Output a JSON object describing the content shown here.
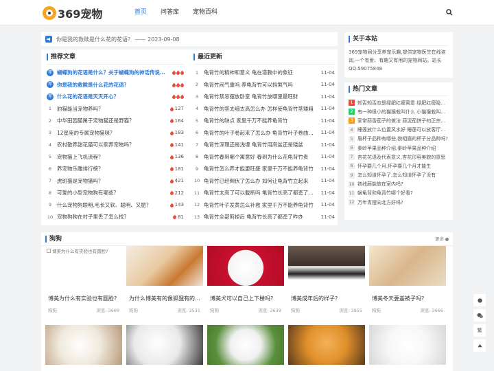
{
  "header": {
    "logo_text": "369宠物",
    "nav": [
      "首页",
      "问答库",
      "宠物百科"
    ]
  },
  "notice": {
    "text": "你是我的救赎是什么花的花语？ —— 2023-09-08"
  },
  "recommended": {
    "title": "推荐文章",
    "items": [
      {
        "rank": "荐",
        "title": "蝴蝶狗的花语是什么？关于蝴蝶狗的神话传说是...",
        "meta": "",
        "top": true
      },
      {
        "rank": "荐",
        "title": "你是我的救赎是什么花的花语？",
        "meta": "",
        "top": true
      },
      {
        "rank": "荐",
        "title": "什么花的花语是天天开心？",
        "meta": "",
        "top": true
      },
      {
        "rank": "1",
        "title": "豹猫能当宠物养吗？",
        "meta": "127",
        "top": false
      },
      {
        "rank": "2",
        "title": "中华田园猫属于宠物猫还是野猫？",
        "meta": "164",
        "top": false
      },
      {
        "rank": "3",
        "title": "12星座的专属宠物猫咪？",
        "meta": "183",
        "top": false
      },
      {
        "rank": "4",
        "title": "农村散养甜花猫可以家养宠物吗？",
        "meta": "141",
        "top": false
      },
      {
        "rank": "5",
        "title": "宠物猫上飞机流程？",
        "meta": "136",
        "top": false
      },
      {
        "rank": "6",
        "title": "养宠物乐雕排行榜？",
        "meta": "181",
        "top": false
      },
      {
        "rank": "7",
        "title": "虎斑猫是宠物猫吗？",
        "meta": "421",
        "top": false
      },
      {
        "rank": "8",
        "title": "可爱的小型宠物狗有哪些？",
        "meta": "212",
        "top": false
      },
      {
        "rank": "9",
        "title": "什么宠物狗眼明,毛长又软、聪明、又肥？",
        "meta": "143",
        "top": false
      },
      {
        "rank": "10",
        "title": "宠物狗狗在村子里丢了怎么找？",
        "meta": "81",
        "top": false
      }
    ]
  },
  "latest": {
    "title": "最近更新",
    "items": [
      {
        "rank": "1",
        "title": "龟背竹的精神和意义 龟在道教中的象征",
        "date": "11-04"
      },
      {
        "rank": "2",
        "title": "龟背竹闹气重吗 养龟背竹可以挡煞气吗",
        "date": "11-04"
      },
      {
        "rank": "3",
        "title": "龟背竹禁忌摆放卧室 龟背竹放哪里最旺财",
        "date": "11-04"
      },
      {
        "rank": "4",
        "title": "龟背竹的茎太细太高怎么办 怎样使龟背竹茎矮粗",
        "date": "11-04"
      },
      {
        "rank": "5",
        "title": "龟背竹的缺点 家里千万不能养龟背竹",
        "date": "11-04"
      },
      {
        "rank": "6",
        "title": "龟背竹的叶子卷起来了怎么办 龟背竹叶子卷曲的原因",
        "date": "11-04"
      },
      {
        "rank": "7",
        "title": "龟背竹深理还是浅埋 龟背竹用高盆还是矮盆",
        "date": "11-04"
      },
      {
        "rank": "8",
        "title": "龟背竹春到哪个寓意好 春到为什么花龟背竹贵",
        "date": "11-04"
      },
      {
        "rank": "9",
        "title": "龟背竹怎么养才能更旺盛 家里千万不能养龟背竹",
        "date": "11-04"
      },
      {
        "rank": "10",
        "title": "龟背竹已经倒伏了怎么办 如何让龟背竹立起来",
        "date": "11-04"
      },
      {
        "rank": "11",
        "title": "龟背竹太高了可以截断吗 龟背竹长高了都歪了咋办",
        "date": "11-04"
      },
      {
        "rank": "12",
        "title": "龟背竹叶子发黄怎么补救 家里千万不能养龟背竹",
        "date": "11-04"
      },
      {
        "rank": "13",
        "title": "龟背竹全部剪掉后 龟背竹长高了都歪了咋办",
        "date": "11-04"
      }
    ]
  },
  "about": {
    "title": "关于本站",
    "text": "369宠物网分享养宠乐趣,提供宠物医生在线咨询,一个有爱、有趣又有用的宠物网站。站长QQ:59075848"
  },
  "hot": {
    "title": "热门文章",
    "items": [
      {
        "num": "1",
        "text": "知否知否应是绿肥红瘦寓意 绿肥红瘦隐喻..."
      },
      {
        "num": "2",
        "text": "有一种很小的猫猴栽叫什么 小猫猴栽叫什..."
      },
      {
        "num": "3",
        "text": "家常蒜香茄子的做法 蒜泥茄饼子的正宗做法"
      },
      {
        "num": "4",
        "text": "睡莲放什么位置风水好 睡莲可以放客厅吗..."
      },
      {
        "num": "5",
        "text": "眉杯子品种有哪些,貌相眉的杯子分品种吗?"
      },
      {
        "num": "6",
        "text": "秦岭苹果品种介绍,秦岭苹果品种介绍"
      },
      {
        "num": "7",
        "text": "杏花花语及代表意义,杏花形容美貌的意思"
      },
      {
        "num": "8",
        "text": "怀孕要几个月,怀孕要几个月才能生"
      },
      {
        "num": "9",
        "text": "怎么知道怀孕了,怎么知道怀孕了没有"
      },
      {
        "num": "10",
        "text": "铁线蕨能放在室内吗?"
      },
      {
        "num": "11",
        "text": "蜗龟背和龟背竹哪个好看?"
      },
      {
        "num": "12",
        "text": "万年青摆向北方好吗?"
      }
    ]
  },
  "dogs": {
    "title": "狗狗",
    "more": "更多",
    "row1": [
      {
        "title": "博美为什么有实验也有圆脸?",
        "cat": "狗狗",
        "views": "浏览: 3669",
        "alt": "博美为什么有实验也有圆脸?"
      },
      {
        "title": "为什么博美有的像狐狸有的...",
        "cat": "狗狗",
        "views": "浏览: 3531",
        "alt": ""
      },
      {
        "title": "博美犬可以自己上下楼吗?",
        "cat": "狗狗",
        "views": "浏览: 3639",
        "alt": ""
      },
      {
        "title": "博美成年后的样子?",
        "cat": "狗狗",
        "views": "浏览: 3955",
        "alt": ""
      },
      {
        "title": "博美冬天要盖被子吗?",
        "cat": "狗狗",
        "views": "浏览: 3666",
        "alt": ""
      }
    ]
  },
  "floating": [
    "返回顶部",
    "微信",
    "繁",
    "顶部"
  ]
}
